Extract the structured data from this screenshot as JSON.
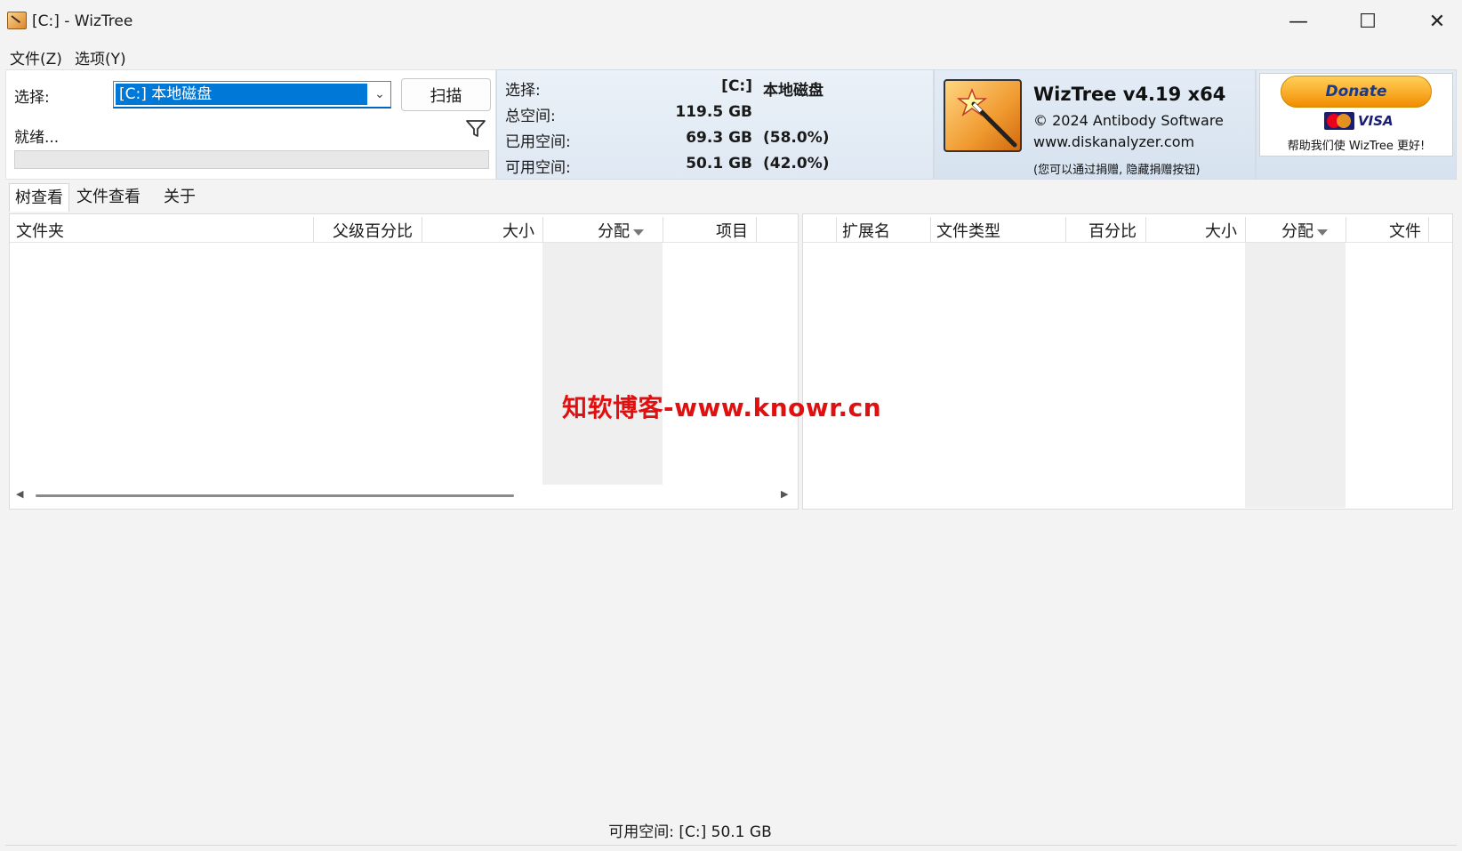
{
  "window": {
    "title": "[C:]  - WizTree",
    "minimize_glyph": "—",
    "maximize_glyph": "☐",
    "close_glyph": "✕"
  },
  "menu": {
    "items": [
      "文件(Z)",
      "选项(Y)"
    ]
  },
  "scan_panel": {
    "select_label": "选择:",
    "drive_value": "[C:] 本地磁盘",
    "scan_button": "扫描",
    "status": "就绪..."
  },
  "drive_info": {
    "select_label": "选择:",
    "drive_letter": "[C:]",
    "drive_name": "本地磁盘",
    "total_label": "总空间:",
    "total_value": "119.5 GB",
    "used_label": "已用空间:",
    "used_value": "69.3 GB",
    "used_pct": "(58.0%)",
    "free_label": "可用空间:",
    "free_value": "50.1 GB",
    "free_pct": "(42.0%)"
  },
  "logo_panel": {
    "title": "WizTree v4.19 x64",
    "copyright": "© 2024 Antibody Software",
    "website": "www.diskanalyzer.com",
    "note": "(您可以通过捐赠, 隐藏捐赠按钮)"
  },
  "donate": {
    "button": "Donate",
    "visa": "VISA",
    "text": "帮助我们使 WizTree 更好!"
  },
  "tabs": [
    "树查看",
    "文件查看",
    "关于"
  ],
  "tree_columns": [
    "文件夹",
    "父级百分比",
    "大小",
    "分配",
    "项目"
  ],
  "ext_columns": [
    "扩展名",
    "文件类型",
    "百分比",
    "大小",
    "分配",
    "文件"
  ],
  "watermark": "知软博客-www.knowr.cn",
  "statusbar": "可用空间: [C:] 50.1 GB",
  "colors": {
    "accent": "#0078d7",
    "watermark": "#e01010",
    "shaded_column": "#efefef"
  }
}
